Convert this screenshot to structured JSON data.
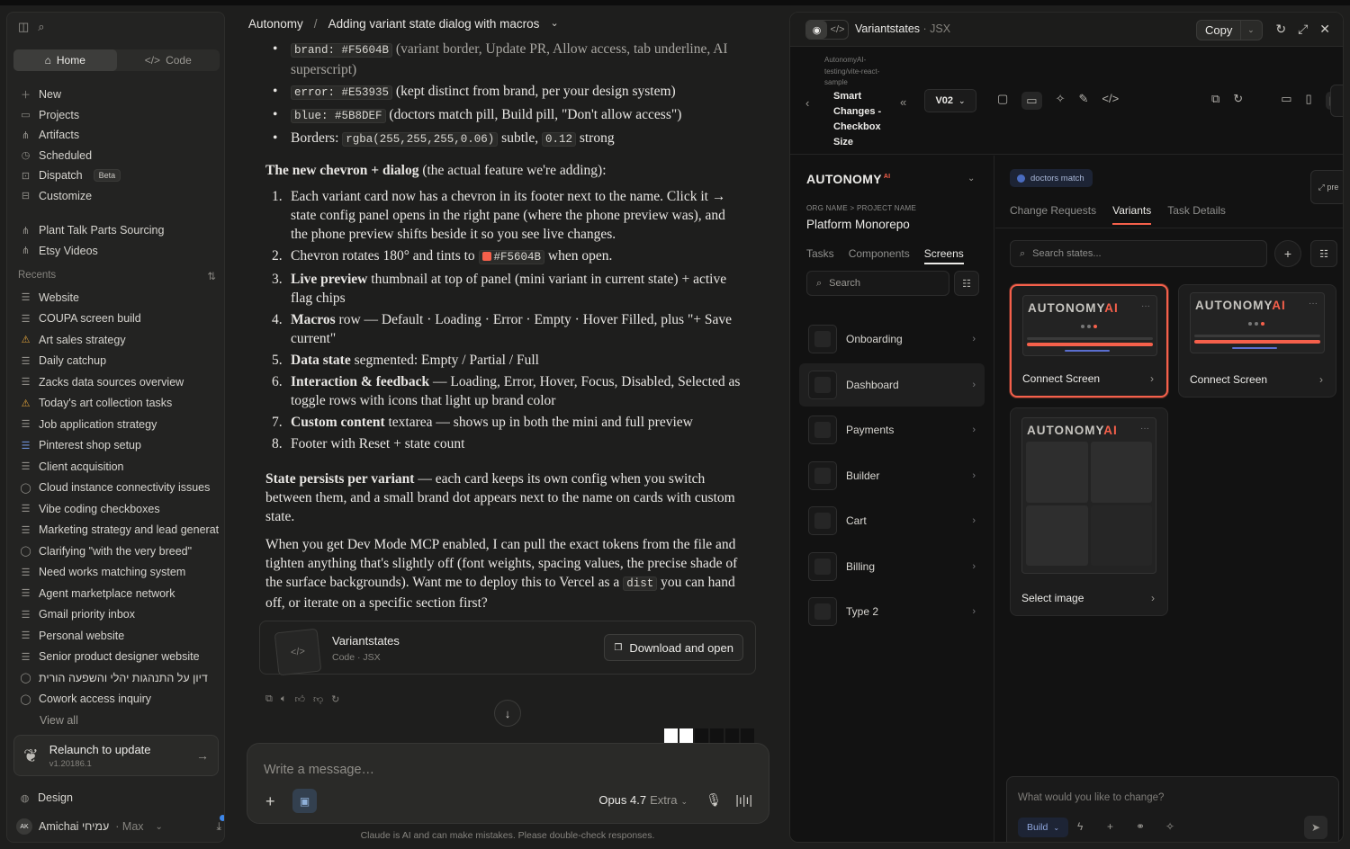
{
  "sidebar": {
    "home": "Home",
    "code": "Code",
    "nav": [
      {
        "icon": "plus-icon",
        "label": "New"
      },
      {
        "icon": "folder-icon",
        "label": "Projects"
      },
      {
        "icon": "artifacts-icon",
        "label": "Artifacts"
      },
      {
        "icon": "clock-icon",
        "label": "Scheduled"
      },
      {
        "icon": "dispatch-icon",
        "label": "Dispatch",
        "badge": "Beta"
      },
      {
        "icon": "customize-icon",
        "label": "Customize"
      }
    ],
    "pinned": [
      {
        "icon": "artifacts-icon",
        "label": "Plant Talk Parts Sourcing"
      },
      {
        "icon": "artifacts-icon",
        "label": "Etsy Videos"
      }
    ],
    "recents_label": "Recents",
    "recents": [
      "Website",
      "COUPA screen build",
      "Art sales strategy",
      "Daily catchup",
      "Zacks data sources overview",
      "Today's art collection tasks",
      "Job application strategy",
      "Pinterest shop setup",
      "Client acquisition",
      "Cloud instance connectivity issues",
      "Vibe coding checkboxes",
      "Marketing strategy and lead generati",
      "Clarifying \"with the very breed\"",
      "Need works matching system",
      "Agent marketplace network",
      "Gmail priority inbox",
      "Personal website",
      "Senior product designer website",
      "דיון על התנהגות יהלי והשפעה הורית",
      "Cowork access inquiry"
    ],
    "view_all": "View all",
    "relaunch_title": "Relaunch to update",
    "relaunch_version": "v1.20186.1",
    "design": "Design",
    "user_initials": "AK",
    "user_name": "Amichai עמיחי",
    "user_plan": "· Max"
  },
  "chat": {
    "breadcrumb_project": "Autonomy",
    "breadcrumb_sep": "/",
    "breadcrumb_title": "Adding variant state dialog with macros",
    "artifact_name": "Variantstates",
    "artifact_meta": "Code · JSX",
    "download_label": "Download and open",
    "composer_placeholder": "Write a message…",
    "model": "Opus 4.7",
    "model_mode": "Extra",
    "disclaimer": "Claude is AI and can make mistakes. Please double-check responses."
  },
  "panel": {
    "title": "Variantstates",
    "title_suffix": "· JSX",
    "copy_label": "Copy",
    "repo": "AutonomyAI-testing/vite-react-sample",
    "branch": "Smart Changes - Checkbox Size",
    "version": "V02",
    "brand_text": "AUTONOMY",
    "brand_sup": "AI",
    "org_label": "ORG NAME > PROJECT NAME",
    "org_name": "Platform Monorepo",
    "left_tabs": [
      "Tasks",
      "Components",
      "Screens"
    ],
    "search_placeholder": "Search",
    "screens": [
      "Onboarding",
      "Dashboard",
      "Payments",
      "Builder",
      "Cart",
      "Billing",
      "Type 2"
    ],
    "pill": "doctors match",
    "right_tabs": [
      "Change Requests",
      "Variants",
      "Task Details"
    ],
    "states_placeholder": "Search states...",
    "pre_label": "pre",
    "card_logo_a": "AUTONOMY",
    "card_logo_b": "AI",
    "cards": [
      {
        "name": "Connect Screen"
      },
      {
        "name": "Connect Screen"
      },
      {
        "name": "Select image"
      }
    ],
    "prompt_placeholder": "What would you like to change?",
    "build_label": "Build"
  },
  "colors": {
    "brand": "#F5604B",
    "accent_blue": "#5B8DEF"
  }
}
